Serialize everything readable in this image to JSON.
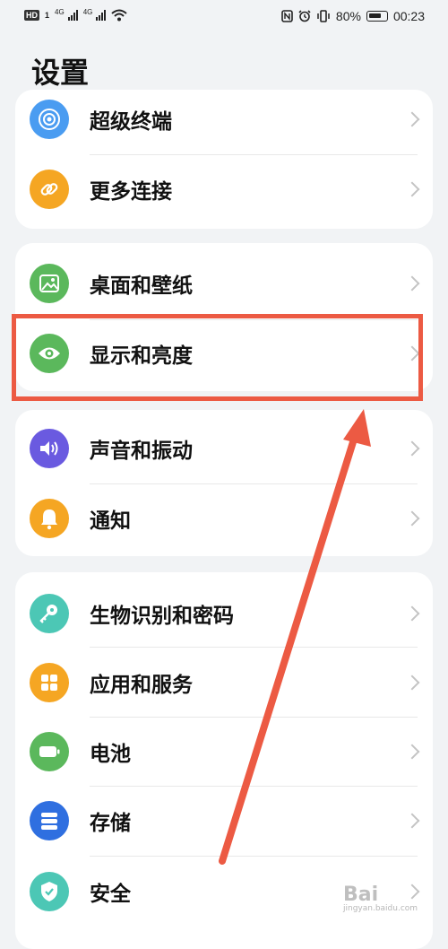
{
  "status_bar": {
    "hd_badge": "HD",
    "sim1_label": "1",
    "net1": "4G",
    "net2": "4G",
    "battery_percent": "80%",
    "time": "00:23"
  },
  "page": {
    "title": "设置"
  },
  "groups": [
    {
      "items": [
        {
          "label": "超级终端",
          "icon": "super-device-icon",
          "color": "#4a9cf1"
        },
        {
          "label": "更多连接",
          "icon": "link-icon",
          "color": "#f5a623"
        }
      ]
    },
    {
      "items": [
        {
          "label": "桌面和壁纸",
          "icon": "wallpaper-icon",
          "color": "#5bb85c"
        },
        {
          "label": "显示和亮度",
          "icon": "eye-icon",
          "color": "#5bb85c"
        }
      ]
    },
    {
      "items": [
        {
          "label": "声音和振动",
          "icon": "sound-icon",
          "color": "#6a5ae0"
        },
        {
          "label": "通知",
          "icon": "bell-icon",
          "color": "#f5a623"
        }
      ]
    },
    {
      "items": [
        {
          "label": "生物识别和密码",
          "icon": "key-icon",
          "color": "#4cc7b5"
        },
        {
          "label": "应用和服务",
          "icon": "apps-icon",
          "color": "#f5a623"
        },
        {
          "label": "电池",
          "icon": "battery-setting-icon",
          "color": "#5bb85c"
        },
        {
          "label": "存储",
          "icon": "storage-icon",
          "color": "#2f6fe0"
        },
        {
          "label": "安全",
          "icon": "shield-icon",
          "color": "#4cc7b5"
        }
      ]
    }
  ],
  "annotation": {
    "color": "#ec5a43",
    "highlighted_item": "显示和亮度"
  },
  "watermark": {
    "text": "Bai",
    "subtext": "jingyan.baidu.com"
  }
}
